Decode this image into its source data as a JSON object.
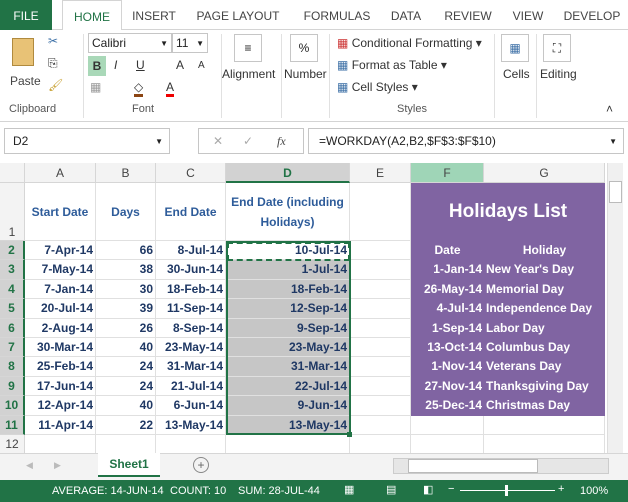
{
  "ribbon_tabs": [
    "FILE",
    "HOME",
    "INSERT",
    "PAGE LAYOUT",
    "FORMULAS",
    "DATA",
    "REVIEW",
    "VIEW",
    "DEVELOP"
  ],
  "active_tab": "HOME",
  "clipboard": {
    "paste": "Paste",
    "label": "Clipboard"
  },
  "font": {
    "name": "Calibri",
    "size": "11",
    "label": "Font",
    "bold": "B",
    "italic": "I",
    "underline": "U"
  },
  "alignment": "Alignment",
  "number": "Number",
  "number_symbol": "%",
  "styles": {
    "conditional": "Conditional Formatting",
    "format_table": "Format as Table",
    "cell_styles": "Cell Styles",
    "label": "Styles"
  },
  "cells": "Cells",
  "editing": "Editing",
  "name_box": "D2",
  "fx": "fx",
  "formula": "=WORKDAY(A2,B2,$F$3:$F$10)",
  "columns": [
    "A",
    "B",
    "C",
    "D",
    "E",
    "F",
    "G"
  ],
  "headers": [
    "Start Date",
    "Days",
    "End Date",
    "End Date (including Holidays)"
  ],
  "rows": [
    [
      "7-Apr-14",
      "66",
      "8-Jul-14",
      "10-Jul-14"
    ],
    [
      "7-May-14",
      "38",
      "30-Jun-14",
      "1-Jul-14"
    ],
    [
      "7-Jan-14",
      "30",
      "18-Feb-14",
      "18-Feb-14"
    ],
    [
      "20-Jul-14",
      "39",
      "11-Sep-14",
      "12-Sep-14"
    ],
    [
      "2-Aug-14",
      "26",
      "8-Sep-14",
      "9-Sep-14"
    ],
    [
      "30-Mar-14",
      "40",
      "23-May-14",
      "23-May-14"
    ],
    [
      "25-Feb-14",
      "24",
      "31-Mar-14",
      "31-Mar-14"
    ],
    [
      "17-Jun-14",
      "24",
      "21-Jul-14",
      "22-Jul-14"
    ],
    [
      "12-Apr-14",
      "40",
      "6-Jun-14",
      "9-Jun-14"
    ],
    [
      "11-Apr-14",
      "22",
      "13-May-14",
      "13-May-14"
    ]
  ],
  "holidays": {
    "title": "Holidays List",
    "date_header": "Date",
    "holiday_header": "Holiday",
    "items": [
      [
        "1-Jan-14",
        "New Year's Day"
      ],
      [
        "26-May-14",
        "Memorial Day"
      ],
      [
        "4-Jul-14",
        "Independence Day"
      ],
      [
        "1-Sep-14",
        "Labor Day"
      ],
      [
        "13-Oct-14",
        "Columbus Day"
      ],
      [
        "1-Nov-14",
        "Veterans Day"
      ],
      [
        "27-Nov-14",
        "Thanksgiving Day"
      ],
      [
        "25-Dec-14",
        "Christmas Day"
      ]
    ]
  },
  "sheet_tab": "Sheet1",
  "status": {
    "average": "AVERAGE: 14-JUN-14",
    "count": "COUNT: 10",
    "sum": "SUM: 28-JUL-44",
    "zoom": "100%"
  },
  "colors": {
    "accent": "#217346",
    "purple": "#8064a2",
    "cell_text": "#1f3864",
    "header_text": "#2e5c9a",
    "selection_fill": "#c6c6c6"
  }
}
